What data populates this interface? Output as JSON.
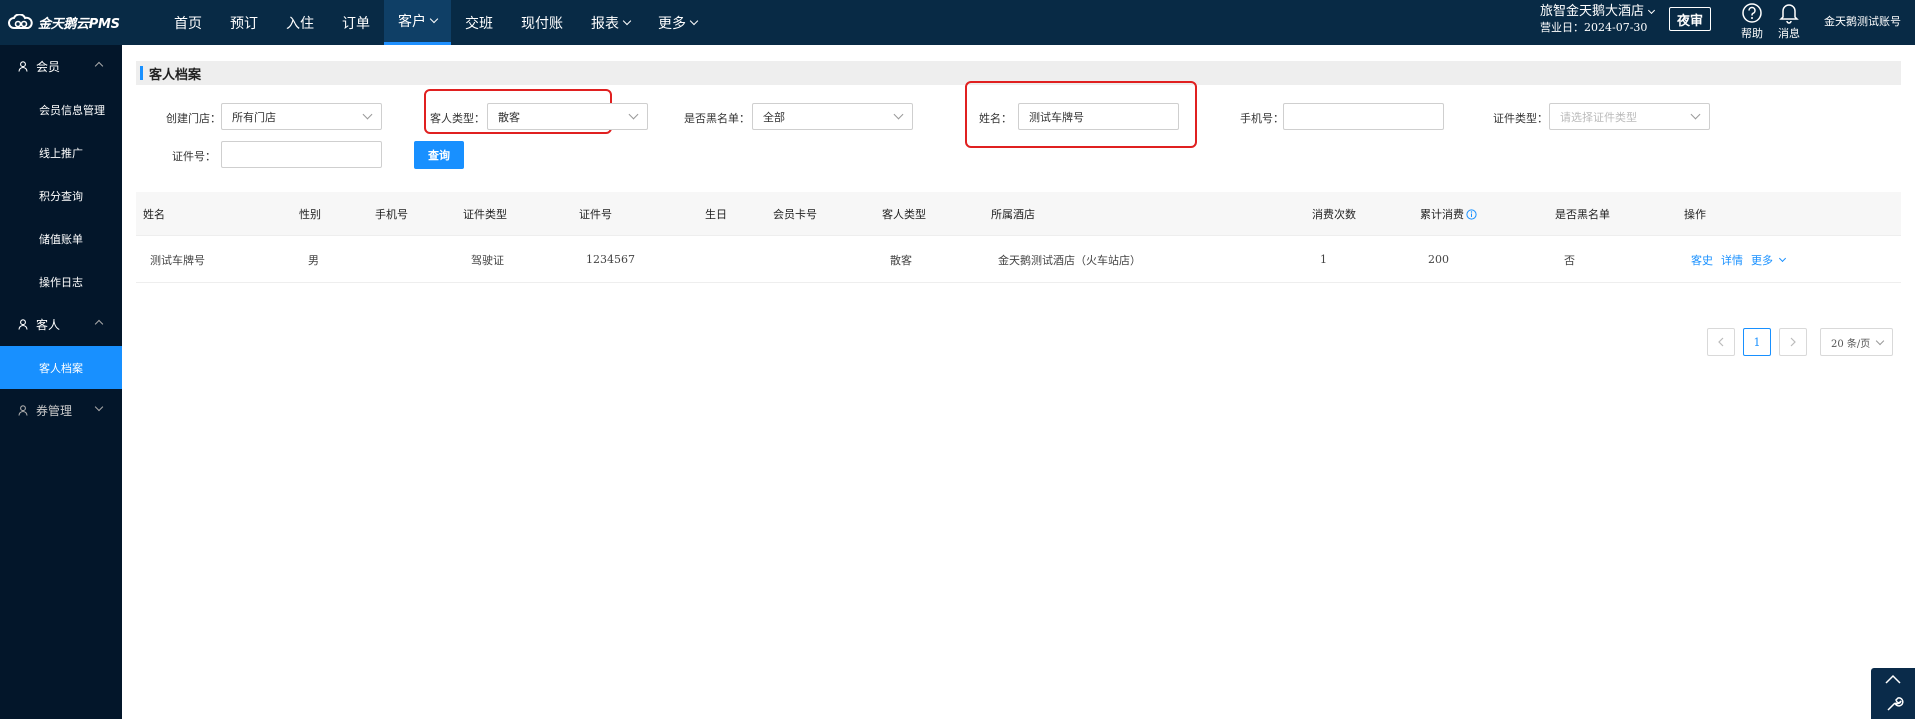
{
  "app": {
    "logo_text": "金天鹅云PMS"
  },
  "nav": {
    "items": [
      {
        "label": "首页"
      },
      {
        "label": "预订"
      },
      {
        "label": "入住"
      },
      {
        "label": "订单"
      },
      {
        "label": "客户"
      },
      {
        "label": "交班"
      },
      {
        "label": "现付账"
      },
      {
        "label": "报表"
      },
      {
        "label": "更多"
      }
    ],
    "active": "客户"
  },
  "header": {
    "hotel_name": "旅智金天鹅大酒店",
    "business_date": "营业日：2024-07-30",
    "night_audit": "夜审",
    "help": "帮助",
    "messages": "消息",
    "account": "金天鹅测试账号"
  },
  "sidebar": {
    "group_member": "会员",
    "member_items": [
      "会员信息管理",
      "线上推广",
      "积分查询",
      "储值账单",
      "操作日志"
    ],
    "group_guest": "客人",
    "guest_items": [
      "客人档案"
    ],
    "group_coupon": "券管理"
  },
  "page": {
    "title": "客人档案",
    "filters": {
      "store_label": "创建门店：",
      "store_value": "所有门店",
      "guest_type_label": "客人类型：",
      "guest_type_value": "散客",
      "blacklist_label": "是否黑名单：",
      "blacklist_value": "全部",
      "name_label": "姓名：",
      "name_value": "测试车牌号",
      "phone_label": "手机号：",
      "phone_value": "",
      "id_type_label": "证件类型：",
      "id_type_placeholder": "请选择证件类型",
      "id_no_label": "证件号：",
      "id_no_value": "",
      "query_button": "查询"
    },
    "table": {
      "headers": [
        "姓名",
        "性别",
        "手机号",
        "证件类型",
        "证件号",
        "生日",
        "会员卡号",
        "客人类型",
        "所属酒店",
        "消费次数",
        "累计消费",
        "是否黑名单",
        "操作"
      ],
      "rows": [
        {
          "name": "测试车牌号",
          "gender": "男",
          "phone": "",
          "id_type": "驾驶证",
          "id_no": "1234567",
          "birthday": "",
          "card_no": "",
          "guest_type": "散客",
          "hotel": "金天鹅测试酒店（火车站店）",
          "visits": "1",
          "total": "200",
          "blacklist": "否",
          "actions": {
            "history": "客史",
            "detail": "详情",
            "more": "更多"
          }
        }
      ]
    },
    "pagination": {
      "current": "1",
      "page_size": "20 条/页"
    }
  },
  "colors": {
    "nav_bg": "#082a45",
    "sidebar_bg": "#03162a",
    "accent": "#1890ff",
    "highlight": "#e02020"
  }
}
